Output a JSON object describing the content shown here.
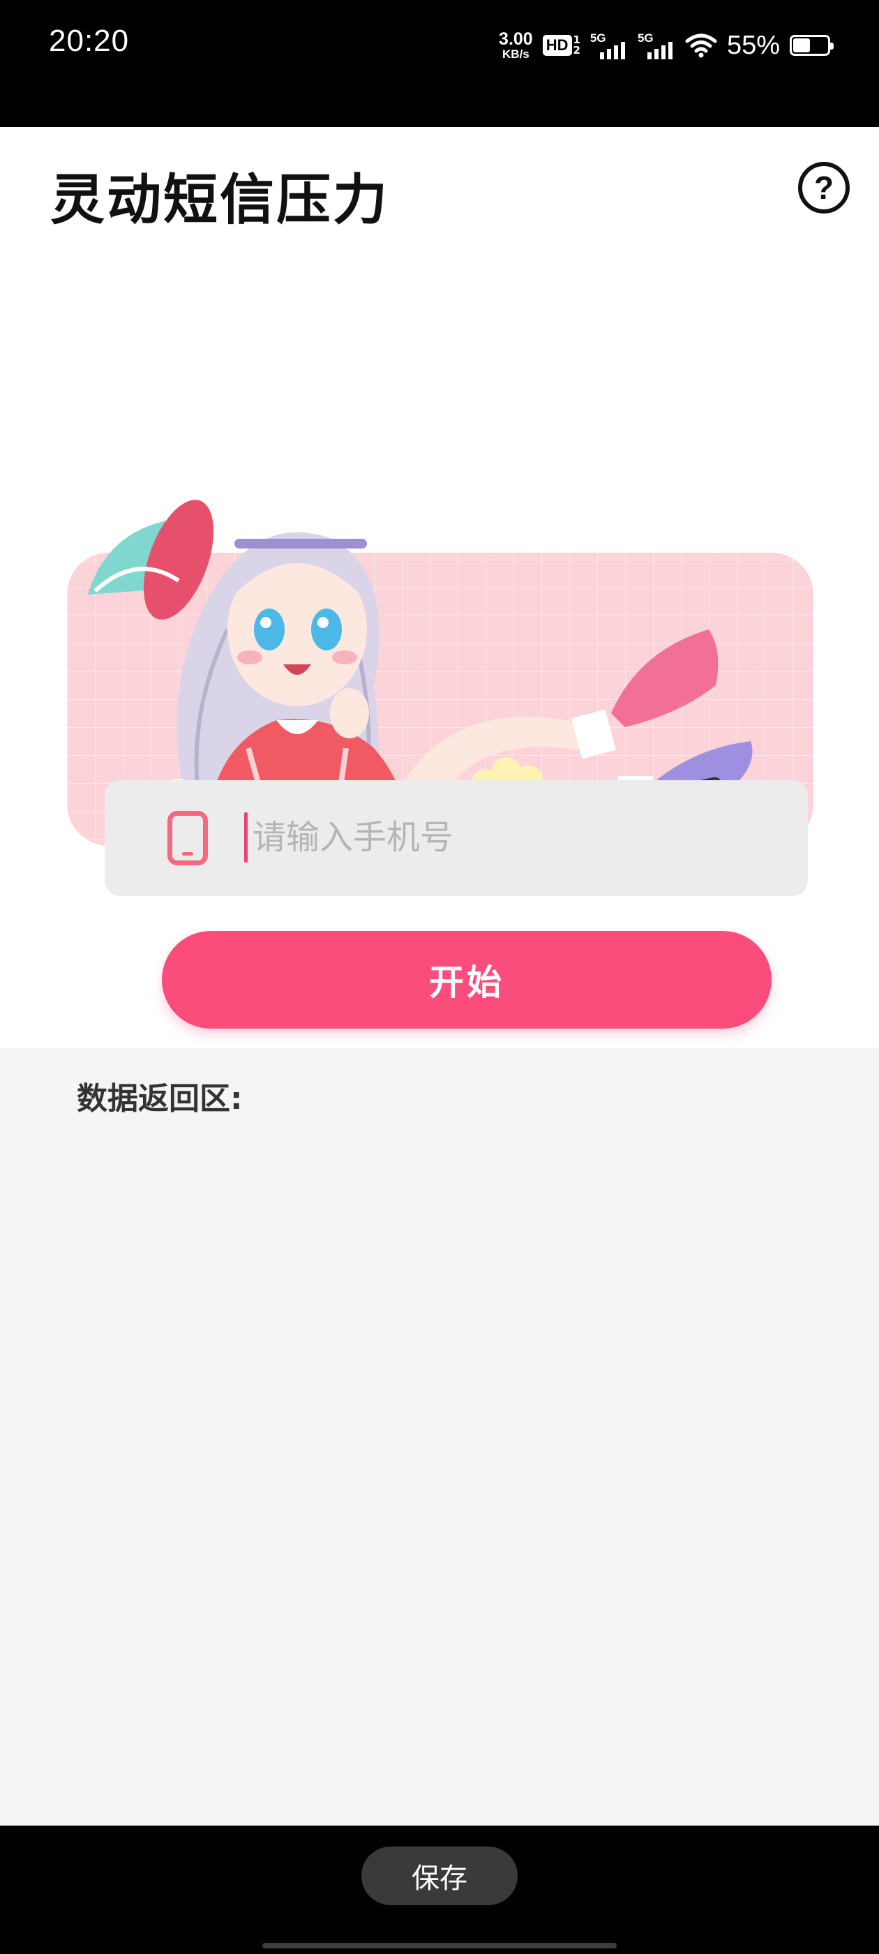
{
  "status_bar": {
    "time": "20:20",
    "net_speed": "3.00",
    "net_speed_unit": "KB/s",
    "hd_label": "HD",
    "hd_sub_top": "1",
    "hd_sub_bottom": "2",
    "signal_1_label": "5G",
    "signal_2_label": "5G",
    "battery_percent": "55%",
    "battery_level": 0.55,
    "icons": [
      "wifi-icon",
      "signal-icon",
      "battery-icon"
    ]
  },
  "header": {
    "title": "灵动短信压力",
    "help_icon": "question-circle-icon",
    "help_glyph": "?"
  },
  "phone_input": {
    "icon": "phone-icon",
    "placeholder": "请输入手机号",
    "value": ""
  },
  "start_button": {
    "label": "开始"
  },
  "data_area": {
    "label": "数据返回区:"
  },
  "bottom_bar": {
    "save_label": "保存"
  },
  "colors": {
    "accent": "#fb4d7c",
    "phone_icon": "#f36a7e",
    "banner_bg": "#fbd3d9",
    "data_bg": "#f5f5f5",
    "input_bg": "#ececec"
  }
}
